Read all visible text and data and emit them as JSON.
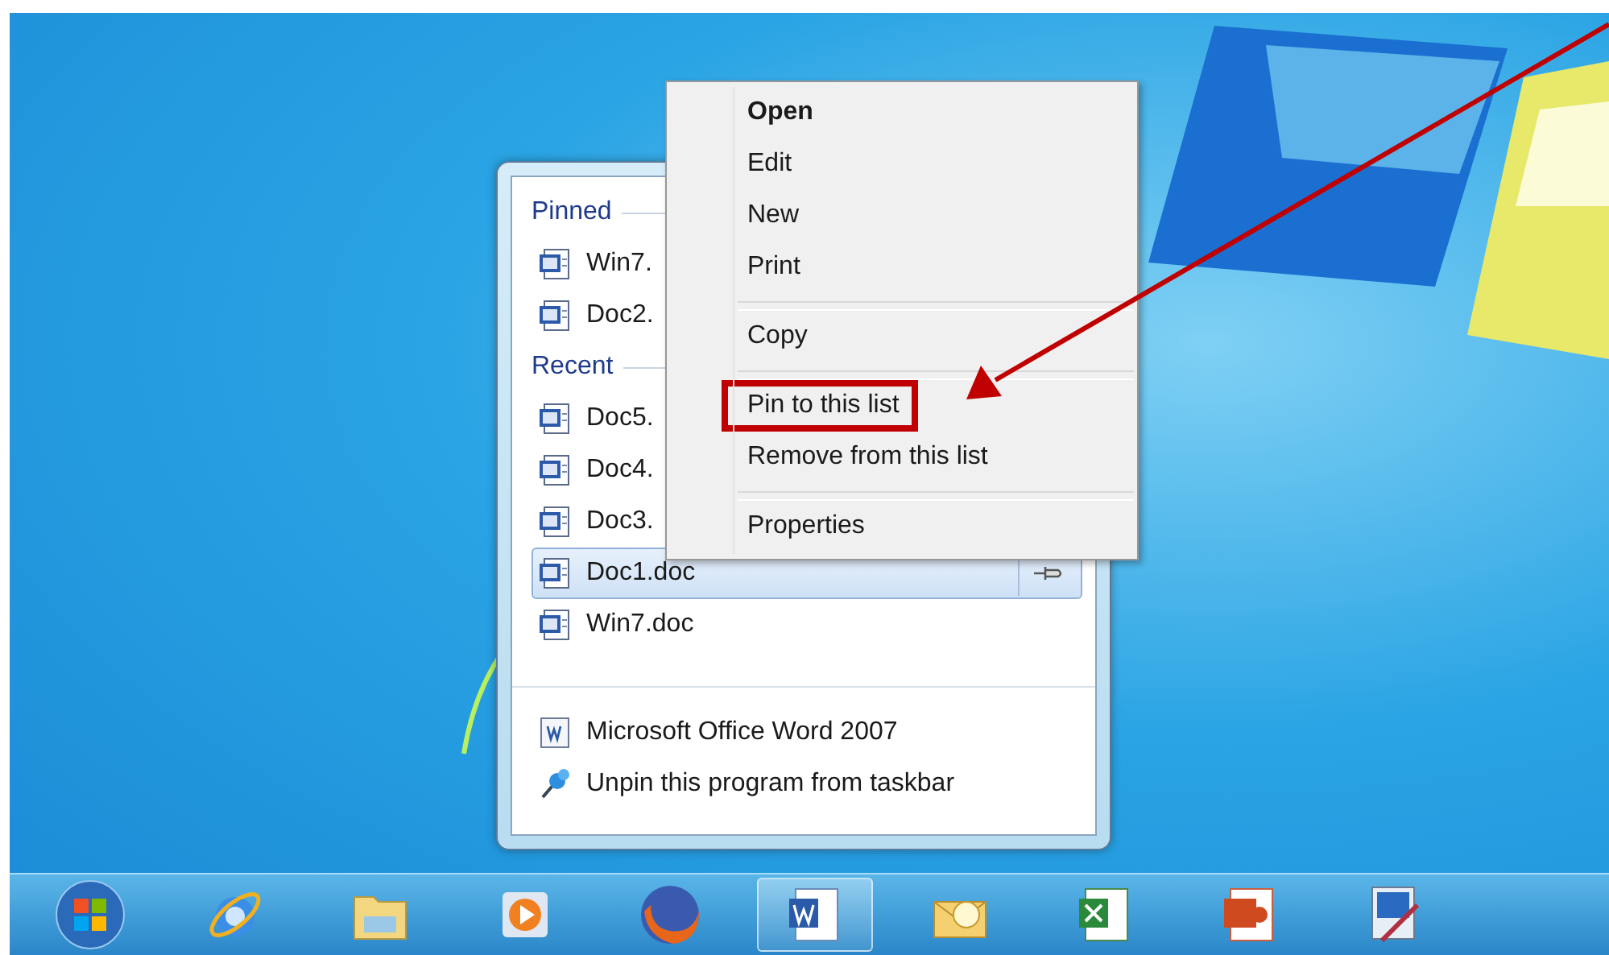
{
  "jump_list": {
    "sections": [
      {
        "title": "Pinned",
        "items": [
          {
            "name": "Win7.",
            "selected": false
          },
          {
            "name": "Doc2.",
            "selected": false
          }
        ]
      },
      {
        "title": "Recent",
        "items": [
          {
            "name": "Doc5.",
            "selected": false
          },
          {
            "name": "Doc4.",
            "selected": false
          },
          {
            "name": "Doc3.",
            "selected": false
          },
          {
            "name": "Doc1.doc",
            "selected": true
          },
          {
            "name": "Win7.doc",
            "selected": false
          }
        ]
      }
    ],
    "tasks": [
      {
        "kind": "app",
        "label": "Microsoft Office Word 2007"
      },
      {
        "kind": "unpin",
        "label": "Unpin this program from taskbar"
      }
    ]
  },
  "context_menu": {
    "groups": [
      {
        "items": [
          {
            "label": "Open",
            "default": true,
            "callout": false
          },
          {
            "label": "Edit",
            "default": false,
            "callout": false
          },
          {
            "label": "New",
            "default": false,
            "callout": false
          },
          {
            "label": "Print",
            "default": false,
            "callout": false
          }
        ]
      },
      {
        "items": [
          {
            "label": "Copy",
            "default": false,
            "callout": false
          }
        ]
      },
      {
        "items": [
          {
            "label": "Pin to this list",
            "default": false,
            "callout": true
          },
          {
            "label": "Remove from this list",
            "default": false,
            "callout": false
          }
        ]
      },
      {
        "items": [
          {
            "label": "Properties",
            "default": false,
            "callout": false
          }
        ]
      }
    ]
  },
  "taskbar": {
    "items": [
      {
        "kind": "start",
        "selected": false
      },
      {
        "kind": "browser",
        "selected": false
      },
      {
        "kind": "folder",
        "selected": false
      },
      {
        "kind": "media",
        "selected": false
      },
      {
        "kind": "firefox",
        "selected": false
      },
      {
        "kind": "word",
        "selected": true
      },
      {
        "kind": "mail",
        "selected": false
      },
      {
        "kind": "sheet",
        "selected": false
      },
      {
        "kind": "slides",
        "selected": false
      },
      {
        "kind": "paint",
        "selected": false
      }
    ]
  }
}
